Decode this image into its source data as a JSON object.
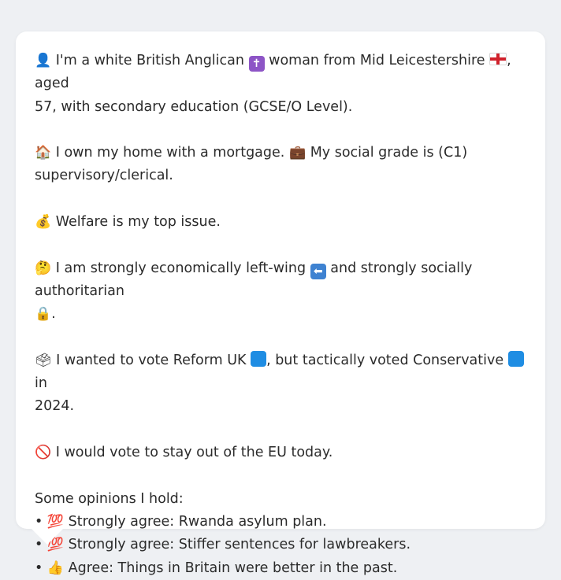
{
  "profile": {
    "identity": {
      "icon": "person-silhouette-icon",
      "text_a": "I'm a white British Anglican",
      "cross_icon": "latin-cross-icon",
      "text_b": "woman from Mid Leicestershire",
      "flag_icon": "england-flag-icon",
      "text_c": ", aged",
      "line2": "57, with secondary education (GCSE/O Level)."
    },
    "housing": {
      "icon": "house-icon",
      "text_a": "I own my home with a mortgage.",
      "briefcase_icon": "briefcase-icon",
      "text_b": "My social grade is (C1)",
      "line2": "supervisory/clerical."
    },
    "issue": {
      "icon": "money-bag-icon",
      "text": "Welfare is my top issue."
    },
    "ideology": {
      "icon": "thinking-face-icon",
      "text_a": "I am strongly economically left-wing",
      "left_arrow_icon": "left-arrow-icon",
      "text_b": "and strongly socially authoritarian",
      "lock_icon": "lock-icon",
      "line2_tail": "."
    },
    "vote": {
      "icon": "ballot-box-icon",
      "text_a": "I wanted to vote Reform UK",
      "reform_color": "#1f8de3",
      "text_b": ", but tactically voted Conservative",
      "conservative_color": "#1f8de3",
      "text_c": "in",
      "line2": "2024."
    },
    "eu": {
      "icon": "prohibited-icon",
      "text": "I would vote to stay out of the EU today."
    },
    "opinions": {
      "heading": "Some opinions I hold:",
      "items": [
        {
          "bullet": "•",
          "icon": "hundred-points-icon",
          "text": "Strongly agree: Rwanda asylum plan."
        },
        {
          "bullet": "•",
          "icon": "hundred-points-icon",
          "text": "Strongly agree: Stiffer sentences for lawbreakers."
        },
        {
          "bullet": "•",
          "icon": "thumbs-up-icon",
          "text": "Agree: Things in Britain were better in the past."
        }
      ]
    }
  },
  "colors": {
    "background": "#eef0f3",
    "bubble": "#ffffff",
    "text": "#2b2b2b"
  }
}
